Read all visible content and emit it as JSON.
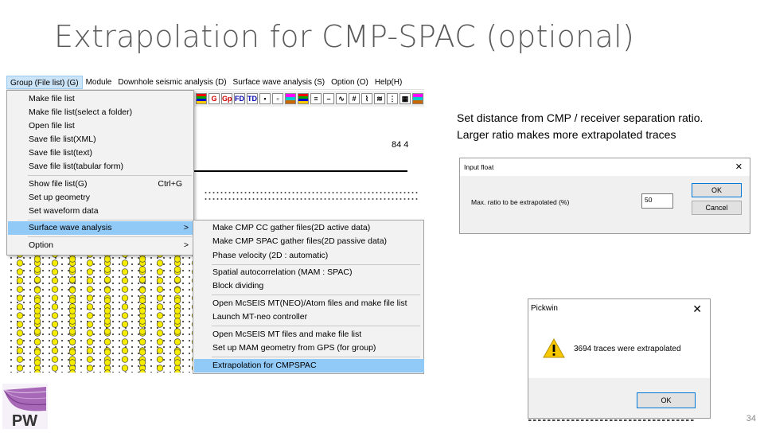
{
  "title": "Extrapolation for CMP-SPAC (optional)",
  "menubar": [
    "Group (File list) (G)",
    "Module",
    "Downhole seismic analysis (D)",
    "Surface wave analysis (S)",
    "Option (O)",
    "Help(H)"
  ],
  "toolbar": [
    "G",
    "Gp",
    "FD",
    "TD"
  ],
  "readout": "84 4",
  "group_menu": {
    "items": [
      {
        "label": "Make file list"
      },
      {
        "label": "Make file list(select a folder)"
      },
      {
        "label": "Open file list"
      },
      {
        "label": "Save file list(XML)"
      },
      {
        "label": "Save file list(text)"
      },
      {
        "label": "Save file list(tabular form)"
      },
      {
        "label": "Show file list(G)",
        "shortcut": "Ctrl+G"
      },
      {
        "label": "Set up geometry"
      },
      {
        "label": "Set waveform data"
      },
      {
        "label": "Surface wave analysis",
        "arrow": ">"
      },
      {
        "label": "Option",
        "arrow": ">"
      }
    ]
  },
  "surface_menu": {
    "items": [
      "Make CMP CC gather files(2D active data)",
      "Make CMP SPAC gather files(2D passive data)",
      "Phase velocity (2D : automatic)",
      "Spatial autocorrelation (MAM : SPAC)",
      "Block dividing",
      "Open McSEIS MT(NEO)/Atom files and make file list",
      "Launch MT-neo controller",
      "Open McSEIS MT files and make file list",
      "Set up MAM geometry from GPS (for group)",
      "Extrapolation for CMPSPAC"
    ]
  },
  "explanation": {
    "line1": "Set distance from CMP / receiver separation ratio.",
    "line2": "Larger ratio makes more extrapolated traces"
  },
  "input_dialog": {
    "title": "Input float",
    "close": "✕",
    "label": "Max. ratio to be extrapolated (%)",
    "value": "50",
    "ok": "OK",
    "cancel": "Cancel"
  },
  "message_dialog": {
    "title": "Pickwin",
    "close": "✕",
    "message": "3694 traces were extrapolated",
    "ok": "OK"
  },
  "logo": "PW",
  "page_number": "34",
  "colors": {
    "menu_highlight": "#91c9f7",
    "trace_fill": "#f5ec00",
    "title_text": "#595959"
  }
}
